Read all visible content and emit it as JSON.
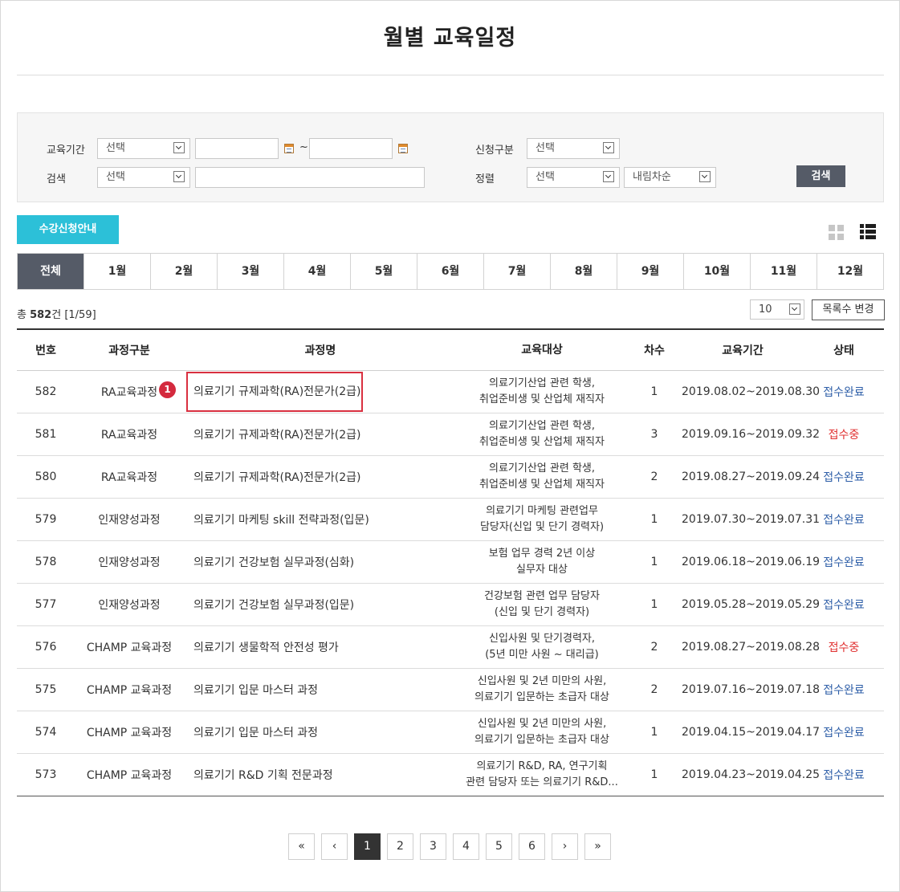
{
  "page": {
    "title": "월별 교육일정"
  },
  "search": {
    "period_label": "교육기간",
    "period_select": "선택",
    "date_from": "",
    "date_to": "",
    "tilde": "~",
    "apply_type_label": "신청구분",
    "apply_type_select": "선택",
    "keyword_label": "검색",
    "keyword_select": "선택",
    "keyword_value": "",
    "sort_label": "정렬",
    "sort_select": "선택",
    "sort_order_select": "내림차순",
    "search_button": "검색"
  },
  "toolbar": {
    "guide_button": "수강신청안내"
  },
  "months": [
    "전체",
    "1월",
    "2월",
    "3월",
    "4월",
    "5월",
    "6월",
    "7월",
    "8월",
    "9월",
    "10월",
    "11월",
    "12월"
  ],
  "summary": {
    "prefix": "총 ",
    "count": "582",
    "suffix": "건 [1/59]",
    "per_page": "10",
    "change_button": "목록수 변경"
  },
  "table": {
    "headers": [
      "번호",
      "과정구분",
      "과정명",
      "교육대상",
      "차수",
      "교육기간",
      "상태"
    ],
    "rows": [
      {
        "no": "582",
        "category": "RA교육과정",
        "name": "의료기기 규제과학(RA)전문가(2급)",
        "target1": "의료기기산업 관련 학생,",
        "target2": "취업준비생 및 산업체 재직자",
        "round": "1",
        "period": "2019.08.02~2019.08.30",
        "status": "접수완료"
      },
      {
        "no": "581",
        "category": "RA교육과정",
        "name": "의료기기 규제과학(RA)전문가(2급)",
        "target1": "의료기기산업 관련 학생,",
        "target2": "취업준비생 및 산업체 재직자",
        "round": "3",
        "period": "2019.09.16~2019.09.32",
        "status": "접수중"
      },
      {
        "no": "580",
        "category": "RA교육과정",
        "name": "의료기기 규제과학(RA)전문가(2급)",
        "target1": "의료기기산업 관련 학생,",
        "target2": "취업준비생 및 산업체 재직자",
        "round": "2",
        "period": "2019.08.27~2019.09.24",
        "status": "접수완료"
      },
      {
        "no": "579",
        "category": "인재양성과정",
        "name": "의료기기 마케팅 skill 전략과정(입문)",
        "target1": "의료기기 마케팅 관련업무",
        "target2": "담당자(신입 및 단기 경력자)",
        "round": "1",
        "period": "2019.07.30~2019.07.31",
        "status": "접수완료"
      },
      {
        "no": "578",
        "category": "인재양성과정",
        "name": "의료기기 건강보험 실무과정(심화)",
        "target1": "보험 업무 경력 2년 이상",
        "target2": "실무자 대상",
        "round": "1",
        "period": "2019.06.18~2019.06.19",
        "status": "접수완료"
      },
      {
        "no": "577",
        "category": "인재양성과정",
        "name": "의료기기 건강보험 실무과정(입문)",
        "target1": "건강보험 관련 업무 담당자",
        "target2": "(신입 및 단기 경력자)",
        "round": "1",
        "period": "2019.05.28~2019.05.29",
        "status": "접수완료"
      },
      {
        "no": "576",
        "category": "CHAMP 교육과정",
        "name": "의료기기 생물학적 안전성 평가",
        "target1": "신입사원 및 단기경력자,",
        "target2": "(5년 미만 사원 ~ 대리급)",
        "round": "2",
        "period": "2019.08.27~2019.08.28",
        "status": "접수중"
      },
      {
        "no": "575",
        "category": "CHAMP 교육과정",
        "name": "의료기기 입문 마스터 과정",
        "target1": "신입사원 및 2년 미만의 사원,",
        "target2": "의료기기 입문하는 초급자 대상",
        "round": "2",
        "period": "2019.07.16~2019.07.18",
        "status": "접수완료"
      },
      {
        "no": "574",
        "category": "CHAMP 교육과정",
        "name": "의료기기 입문 마스터 과정",
        "target1": "신입사원 및 2년 미만의 사원,",
        "target2": "의료기기 입문하는 초급자 대상",
        "round": "1",
        "period": "2019.04.15~2019.04.17",
        "status": "접수완료"
      },
      {
        "no": "573",
        "category": "CHAMP 교육과정",
        "name": "의료기기 R&D 기획 전문과정",
        "target1": "의료기기 R&D, RA, 연구기획",
        "target2": "관련 담당자 또는 의료기기 R&D...",
        "round": "1",
        "period": "2019.04.23~2019.04.25",
        "status": "접수완료"
      }
    ]
  },
  "annotation": {
    "badge": "1"
  },
  "pagination": {
    "first": "«",
    "prev": "‹",
    "next": "›",
    "last": "»",
    "pages": [
      "1",
      "2",
      "3",
      "4",
      "5",
      "6"
    ]
  },
  "colors": {
    "accent": "#2cc0d8",
    "dark": "#555b67",
    "status_done": "#2f5fa8",
    "status_open": "#e03030",
    "highlight": "#d93040"
  }
}
